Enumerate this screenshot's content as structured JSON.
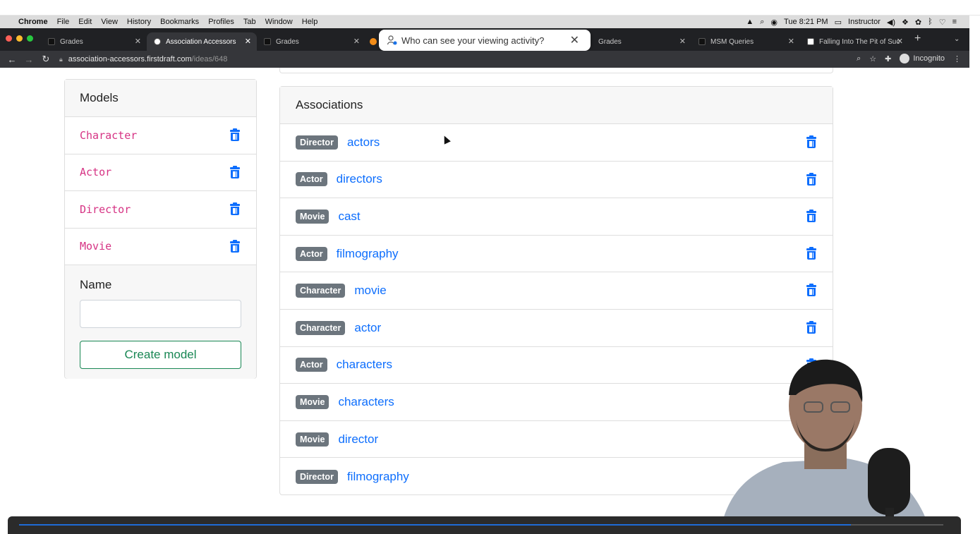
{
  "mac_menu": {
    "app": "Chrome",
    "items": [
      "File",
      "Edit",
      "View",
      "History",
      "Bookmarks",
      "Profiles",
      "Tab",
      "Window",
      "Help"
    ],
    "clock": "Tue 8:21 PM",
    "user": "Instructor"
  },
  "tabs": [
    {
      "title": "Grades",
      "active": false
    },
    {
      "title": "Association Accessors",
      "active": true
    },
    {
      "title": "Grades",
      "active": false
    },
    {
      "title": "Grades",
      "active": false
    },
    {
      "title": "MSM Queries",
      "active": false
    },
    {
      "title": "Falling Into The Pit of Succ",
      "active": false
    }
  ],
  "popup": {
    "text": "Who can see your viewing activity?"
  },
  "address": {
    "domain": "association-accessors.firstdraft.com",
    "path": "/ideas/648",
    "incognito_label": "Incognito"
  },
  "models_card": {
    "title": "Models",
    "items": [
      "Character",
      "Actor",
      "Director",
      "Movie"
    ],
    "form_label": "Name",
    "input_value": "",
    "button": "Create model"
  },
  "associations_card": {
    "title": "Associations",
    "rows": [
      {
        "model": "Director",
        "name": "actors"
      },
      {
        "model": "Actor",
        "name": "directors"
      },
      {
        "model": "Movie",
        "name": "cast"
      },
      {
        "model": "Actor",
        "name": "filmography"
      },
      {
        "model": "Character",
        "name": "movie"
      },
      {
        "model": "Character",
        "name": "actor"
      },
      {
        "model": "Actor",
        "name": "characters"
      },
      {
        "model": "Movie",
        "name": "characters"
      },
      {
        "model": "Movie",
        "name": "director"
      },
      {
        "model": "Director",
        "name": "filmography"
      }
    ]
  },
  "video": {
    "progress": 0.9
  },
  "colors": {
    "link": "#0d6efd",
    "model_code": "#d63384",
    "badge": "#6c757d",
    "create_button": "#198754"
  }
}
